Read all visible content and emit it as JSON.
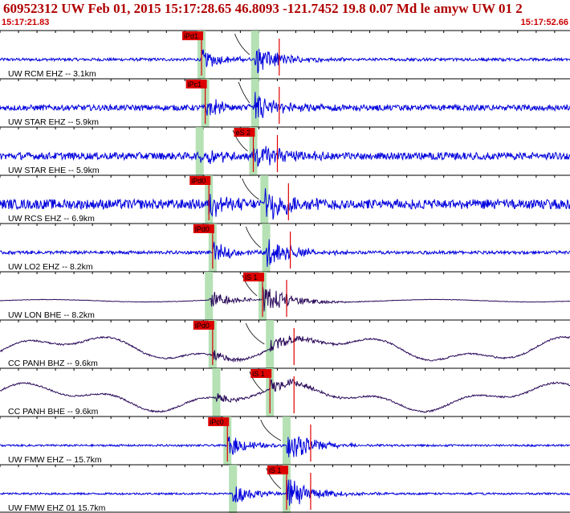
{
  "header": {
    "title": "60952312 UW Feb 01, 2015 15:17:28.65   46.8093 -121.7452 19.8 0.07 Md le amyw UW 01   2",
    "time_start": "15:17:21.83",
    "time_end": "15:17:52.66"
  },
  "colors": {
    "trace_blue": "#0000dd",
    "trace_dark": "#2a0a5a",
    "pick_red": "#dd0000",
    "window_green": "#a8dca8",
    "header_red": "#b00000"
  },
  "chart_data": {
    "type": "line",
    "title": "60952312 UW Feb 01, 2015 15:17:28.65   46.8093 -121.7452 19.8 0.07 Md le amyw UW 01   2",
    "time_range": [
      "15:17:21.83",
      "15:17:52.66"
    ],
    "xlim_seconds": [
      0,
      30.83
    ],
    "grid": false,
    "traces": [
      {
        "label": "UW RCM EHZ -- 3.1km",
        "pick": "iPd1",
        "pick_time": 10.9,
        "s_time": 13.8,
        "station_kind": "short",
        "noise": 0.18,
        "coda_amp": 0.9
      },
      {
        "label": "UW STAR EHZ -- 5.9km",
        "pick": "iPc1",
        "pick_time": 11.1,
        "s_time": 13.8,
        "station_kind": "short",
        "noise": 0.35,
        "coda_amp": 0.9
      },
      {
        "label": "UW STAR EHE -- 5.9km",
        "pick": "eS 2",
        "pick_time": 13.7,
        "s_time": 13.7,
        "station_kind": "short",
        "noise": 0.45,
        "coda_amp": 0.9
      },
      {
        "label": "UW RCS EHZ -- 6.9km",
        "pick": "iPd0",
        "pick_time": 11.3,
        "s_time": 14.3,
        "station_kind": "short",
        "noise": 0.6,
        "coda_amp": 1.0
      },
      {
        "label": "UW LO2 EHZ -- 8.2km",
        "pick": "iPd0",
        "pick_time": 11.5,
        "s_time": 14.4,
        "station_kind": "short",
        "noise": 0.2,
        "coda_amp": 0.9
      },
      {
        "label": "UW LON BHE -- 8.2km",
        "pick": "iS 1",
        "pick_time": 14.2,
        "s_time": 14.2,
        "station_kind": "broad_quiet",
        "noise": 0.05,
        "coda_amp": 1.0
      },
      {
        "label": "CC PANH BHZ -- 9.6km",
        "pick": "iPd0",
        "pick_time": 11.5,
        "s_time": 14.6,
        "station_kind": "broad_wave",
        "noise": 0.12,
        "coda_amp": 0.5
      },
      {
        "label": "CC PANH BHE -- 9.6km",
        "pick": "iS 1",
        "pick_time": 14.6,
        "s_time": 14.6,
        "station_kind": "broad_wave",
        "noise": 0.1,
        "coda_amp": 0.5
      },
      {
        "label": "UW FMW EHZ -- 15.7km",
        "pick": "iPc0",
        "pick_time": 12.3,
        "s_time": 15.5,
        "station_kind": "short",
        "noise": 0.12,
        "coda_amp": 1.0
      },
      {
        "label": "UW FMW EHZ 01 15.7km",
        "pick": "iS 1",
        "pick_time": 15.5,
        "s_time": 15.5,
        "station_kind": "short",
        "noise": 0.12,
        "coda_amp": 1.0
      }
    ]
  }
}
